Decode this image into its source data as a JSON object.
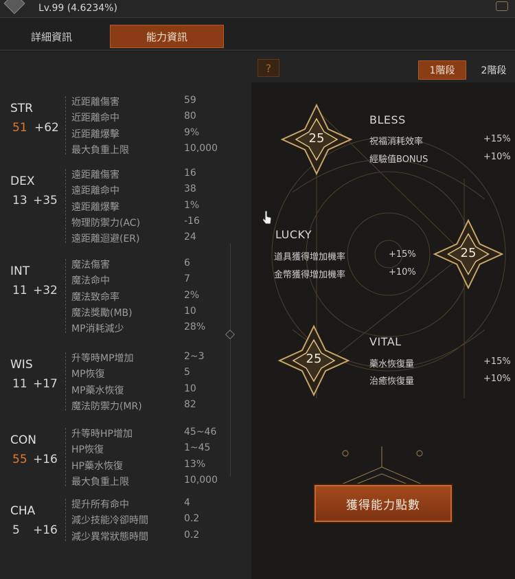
{
  "header": {
    "level_text": "Lv.99 (4.6234%)"
  },
  "tabs": [
    {
      "label": "詳細資訊",
      "active": false
    },
    {
      "label": "能力資訊",
      "active": true
    }
  ],
  "stats": [
    {
      "name": "STR",
      "base": "51",
      "bonus": "+62",
      "base_color": "orange",
      "rows": [
        {
          "label": "近距離傷害",
          "value": "59"
        },
        {
          "label": "近距離命中",
          "value": "80"
        },
        {
          "label": "近距離爆擊",
          "value": "9%"
        },
        {
          "label": "最大負重上限",
          "value": "10,000"
        }
      ]
    },
    {
      "name": "DEX",
      "base": "13",
      "bonus": "+35",
      "base_color": "normal",
      "rows": [
        {
          "label": "遠距離傷害",
          "value": "16"
        },
        {
          "label": "遠距離命中",
          "value": "38"
        },
        {
          "label": "遠距離爆擊",
          "value": "1%"
        },
        {
          "label": "物理防禦力(AC)",
          "value": "-16"
        },
        {
          "label": "遠距離迴避(ER)",
          "value": "24"
        }
      ]
    },
    {
      "name": "INT",
      "base": "11",
      "bonus": "+32",
      "base_color": "normal",
      "rows": [
        {
          "label": "魔法傷害",
          "value": "6"
        },
        {
          "label": "魔法命中",
          "value": "7"
        },
        {
          "label": "魔法致命率",
          "value": "2%"
        },
        {
          "label": "魔法獎勵(MB)",
          "value": "10"
        },
        {
          "label": "MP消耗減少",
          "value": "28%"
        }
      ]
    },
    {
      "name": "WIS",
      "base": "11",
      "bonus": "+17",
      "base_color": "normal",
      "rows": [
        {
          "label": "升等時MP增加",
          "value": "2~3"
        },
        {
          "label": "MP恢復",
          "value": "5"
        },
        {
          "label": "MP藥水恢復",
          "value": "10"
        },
        {
          "label": "魔法防禦力(MR)",
          "value": "82"
        }
      ]
    },
    {
      "name": "CON",
      "base": "55",
      "bonus": "+16",
      "base_color": "orange",
      "rows": [
        {
          "label": "升等時HP增加",
          "value": "45~46"
        },
        {
          "label": "HP恢復",
          "value": "1~45"
        },
        {
          "label": "HP藥水恢復",
          "value": "13%"
        },
        {
          "label": "最大負重上限",
          "value": "10,000"
        }
      ]
    },
    {
      "name": "CHA",
      "base": "5",
      "bonus": "+16",
      "base_color": "normal",
      "rows": [
        {
          "label": "提升所有命中",
          "value": "4"
        },
        {
          "label": "減少技能冷卻時間",
          "value": "0.2"
        },
        {
          "label": "減少異常狀態時間",
          "value": "0.2"
        }
      ]
    }
  ],
  "ability": {
    "help_label": "?",
    "stages": [
      {
        "label": "1階段",
        "active": true
      },
      {
        "label": "2階段",
        "active": false
      }
    ],
    "bless": {
      "title": "BLESS",
      "points": "25",
      "effects": [
        {
          "label": "祝福消耗效率",
          "value": "+15%"
        },
        {
          "label": "經驗值BONUS",
          "value": "+10%"
        }
      ]
    },
    "lucky": {
      "title": "LUCKY",
      "points": "25",
      "effects": [
        {
          "label": "道具獲得增加機率",
          "value": "+15%"
        },
        {
          "label": "金幣獲得增加機率",
          "value": "+10%"
        }
      ]
    },
    "vital": {
      "title": "VITAL",
      "points": "25",
      "effects": [
        {
          "label": "藥水恢復量",
          "value": "+15%"
        },
        {
          "label": "治癒恢復量",
          "value": "+10%"
        }
      ]
    },
    "get_button_label": "獲得能力點數"
  },
  "colors": {
    "accent": "#8a3c14",
    "accent_border": "#b4592a",
    "orange_value": "#e07a2a",
    "gold_line": "#b8935a"
  }
}
